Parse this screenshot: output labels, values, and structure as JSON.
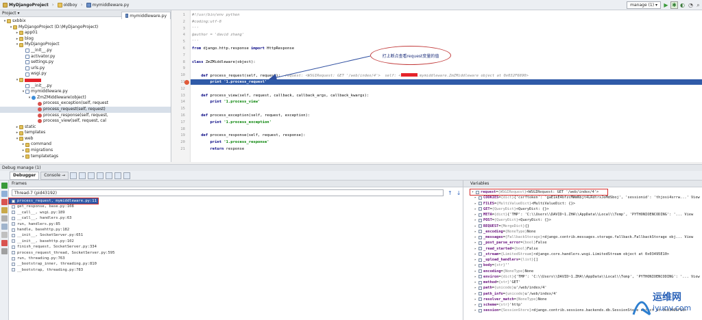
{
  "navbar": {
    "crumbs": [
      "MyDjangoProject",
      "oldboy",
      "mymiddleware.py"
    ],
    "run_config": "manage (1)"
  },
  "project_panel": {
    "header": "Project",
    "tree": [
      {
        "label": "sxbbix",
        "icon": "folder",
        "indent": 0,
        "open": true
      },
      {
        "label": "MyDjangoProject  (D:\\MyDjangoProject)",
        "icon": "folder",
        "indent": 1,
        "open": true
      },
      {
        "label": "app01",
        "icon": "folder",
        "indent": 2,
        "open": false
      },
      {
        "label": "blog",
        "icon": "folder",
        "indent": 2,
        "open": false
      },
      {
        "label": "MyDjangoProject",
        "icon": "folder",
        "indent": 2,
        "open": true
      },
      {
        "label": "__init__.py",
        "icon": "py",
        "indent": 3
      },
      {
        "label": "activator.py",
        "icon": "py",
        "indent": 3
      },
      {
        "label": "settings.py",
        "icon": "py",
        "indent": 3
      },
      {
        "label": "urls.py",
        "icon": "py",
        "indent": 3
      },
      {
        "label": "wsgi.py",
        "icon": "py",
        "indent": 3
      },
      {
        "label": "",
        "icon": "folder",
        "indent": 2,
        "open": true,
        "redacted": true
      },
      {
        "label": "__init__.py",
        "icon": "py",
        "indent": 3
      },
      {
        "label": "mymiddleware.py",
        "icon": "py",
        "indent": 3,
        "open": true
      },
      {
        "label": "ZmZMiddleware(object)",
        "icon": "class",
        "indent": 4,
        "open": true
      },
      {
        "label": "process_exception(self, request",
        "icon": "meth",
        "indent": 5
      },
      {
        "label": "process_request(self, request)",
        "icon": "meth",
        "indent": 5,
        "selected": true
      },
      {
        "label": "process_response(self, request,",
        "icon": "meth",
        "indent": 5
      },
      {
        "label": "process_view(self, request, cal",
        "icon": "meth",
        "indent": 5
      },
      {
        "label": "static",
        "icon": "folder",
        "indent": 2,
        "open": false
      },
      {
        "label": "templates",
        "icon": "folder",
        "indent": 2,
        "open": false
      },
      {
        "label": "web",
        "icon": "folder",
        "indent": 2,
        "open": true
      },
      {
        "label": "command",
        "icon": "folder",
        "indent": 3,
        "open": false
      },
      {
        "label": "migrations",
        "icon": "folder",
        "indent": 3,
        "open": false
      },
      {
        "label": "templatetags",
        "icon": "folder",
        "indent": 3,
        "open": false
      }
    ]
  },
  "editor": {
    "tab": "mymiddleware.py",
    "lines": [
      {
        "n": "1",
        "html": "<span class='cmt'>#!/usr/bin/env python</span>"
      },
      {
        "n": "2",
        "html": "<span class='cmt'>#coding:utf-8</span>"
      },
      {
        "n": "3",
        "html": "<span class='cmt'>'''</span>"
      },
      {
        "n": "4",
        "html": "<span class='cmt'>@author = 'david zhang'</span>"
      },
      {
        "n": "5",
        "html": "<span class='cmt'>'''</span>"
      },
      {
        "n": "6",
        "html": "<span class='kw'>from</span> django.http.response <span class='kw'>import</span> HttpResponse"
      },
      {
        "n": "7",
        "html": ""
      },
      {
        "n": "8",
        "html": "<span class='kw'>class</span> ZmZMiddleware(object):"
      },
      {
        "n": "9",
        "html": ""
      },
      {
        "n": "10",
        "html": "    <span class='kw'>def</span> process_request(self, request):  <span class='hint'>request: &lt;WSGIRequest: GET '/web/index/4'&gt;  self: &lt;</span><span class='redact'></span><span class='hint'>.mymiddleware.ZmZMiddleware object at 0x032F6890&gt;</span>"
      },
      {
        "n": "11",
        "html": "        <span class='kw' style='color:#fff'>print</span> <span style='color:#fff;font-weight:bold'>'1.process_request'</span>"
      },
      {
        "n": "12",
        "html": ""
      },
      {
        "n": "13",
        "html": "    <span class='kw'>def</span> process_view(self, request, callback, callback_args, callback_kwargs):"
      },
      {
        "n": "14",
        "html": "        <span class='kw'>print</span> <span class='str'>'1.process_view'</span>"
      },
      {
        "n": "15",
        "html": ""
      },
      {
        "n": "16",
        "html": "    <span class='kw'>def</span> process_exception(self, request, exception):"
      },
      {
        "n": "17",
        "html": "        <span class='kw'>print</span> <span class='str'>'1.process_exception'</span>"
      },
      {
        "n": "18",
        "html": ""
      },
      {
        "n": "19",
        "html": "    <span class='kw'>def</span> process_response(self, request, response):"
      },
      {
        "n": "20",
        "html": "        <span class='kw'>print</span> <span class='str'>'1.process_response'</span>"
      },
      {
        "n": "21",
        "html": "        <span class='kw'>return</span> response"
      }
    ]
  },
  "annotation": "打上断点查看request变量的值",
  "debug": {
    "title": "Debug   manage (1)",
    "tabs": [
      "Debugger",
      "Console"
    ],
    "frames_header": "Frames",
    "thread": "Thread-7 (pid43192)",
    "frames": [
      "process_request, mymiddleware.py:11",
      "get_response, base.py:108",
      "__call__, wsgi.py:189",
      "__call__, handlers.py:63",
      "run, handlers.py:85",
      "handle, basehttp.py:182",
      "__init__, SocketServer.py:651",
      "__init__, basehttp.py:102",
      "finish_request, SocketServer.py:334",
      "process_request_thread, SocketServer.py:595",
      "run, threading.py:763",
      "__bootstrap_inner, threading.py:810",
      "__bootstrap, threading.py:783"
    ],
    "variables_header": "Variables",
    "variables": [
      {
        "name": "request",
        "type": "{WSGIRequest}",
        "value": "<WSGIRequest: GET '/web/index/4'>",
        "indent": 0,
        "selected": true
      },
      {
        "name": "COOKIES",
        "type": "{dict}",
        "value": "{'csrftoken': 'gaE1kE4bfzcMWmNbjt4LRdtrxJoMdSboj', 'sessionid': 'thjosi4srrw...' View",
        "indent": 1
      },
      {
        "name": "FILES",
        "type": "{MultiValueDict}",
        "value": "<MultiValueDict: {}>",
        "indent": 1
      },
      {
        "name": "GET",
        "type": "{QueryDict}",
        "value": "<QueryDict: {}>",
        "indent": 1
      },
      {
        "name": "META",
        "type": "{dict}",
        "value": "{'TMP': 'C:\\\\Users\\\\DAVID~1.ZHA\\\\AppData\\\\Local\\\\Temp', 'PYTHONIOENCODING': '... View",
        "indent": 1
      },
      {
        "name": "POST",
        "type": "{QueryDict}",
        "value": "<QueryDict: {}>",
        "indent": 1
      },
      {
        "name": "REQUEST",
        "type": "{MergeDict}",
        "value": "{}",
        "indent": 1
      },
      {
        "name": "_encoding",
        "type": "{NoneType}",
        "value": "None",
        "indent": 1
      },
      {
        "name": "_messages",
        "type": "{FallbackStorage}",
        "value": "<django.contrib.messages.storage.fallback.FallbackStorage obj... View",
        "indent": 1
      },
      {
        "name": "_post_parse_error",
        "type": "{bool}",
        "value": "False",
        "indent": 1
      },
      {
        "name": "_read_started",
        "type": "{bool}",
        "value": "False",
        "indent": 1
      },
      {
        "name": "_stream",
        "type": "{LimitedStream}",
        "value": "<django.core.handlers.wsgi.LimitedStream object at 0x03495E10>",
        "indent": 1
      },
      {
        "name": "_upload_handlers",
        "type": "{list}",
        "value": "[]",
        "indent": 1
      },
      {
        "name": "body",
        "type": "{str}",
        "value": "''",
        "indent": 1
      },
      {
        "name": "encoding",
        "type": "{NoneType}",
        "value": "None",
        "indent": 1
      },
      {
        "name": "environ",
        "type": "{dict}",
        "value": "{'TMP': 'C:\\\\Users\\\\DAVID~1.ZHA\\\\AppData\\\\Local\\\\Temp', 'PYTHONIOENCODING': '... View",
        "indent": 1
      },
      {
        "name": "method",
        "type": "{str}",
        "value": "'GET'",
        "indent": 1
      },
      {
        "name": "path",
        "type": "{unicode}",
        "value": "u'/web/index/4'",
        "indent": 1
      },
      {
        "name": "path_info",
        "type": "{unicode}",
        "value": "u'/web/index/4'",
        "indent": 1
      },
      {
        "name": "resolver_match",
        "type": "{NoneType}",
        "value": "None",
        "indent": 1
      },
      {
        "name": "scheme",
        "type": "{str}",
        "value": "'http'",
        "indent": 1
      },
      {
        "name": "session",
        "type": "{SessionStore}",
        "value": "<django.contrib.sessions.backends.db.SessionStore object at 0x03495F10>",
        "indent": 1
      }
    ]
  },
  "watermark": {
    "cn": "运维网",
    "en": "iyunv.com"
  },
  "colors": {
    "accent": "#2f5aa8",
    "breakpoint": "#e05a3a",
    "annotation": "#c23a3a"
  }
}
